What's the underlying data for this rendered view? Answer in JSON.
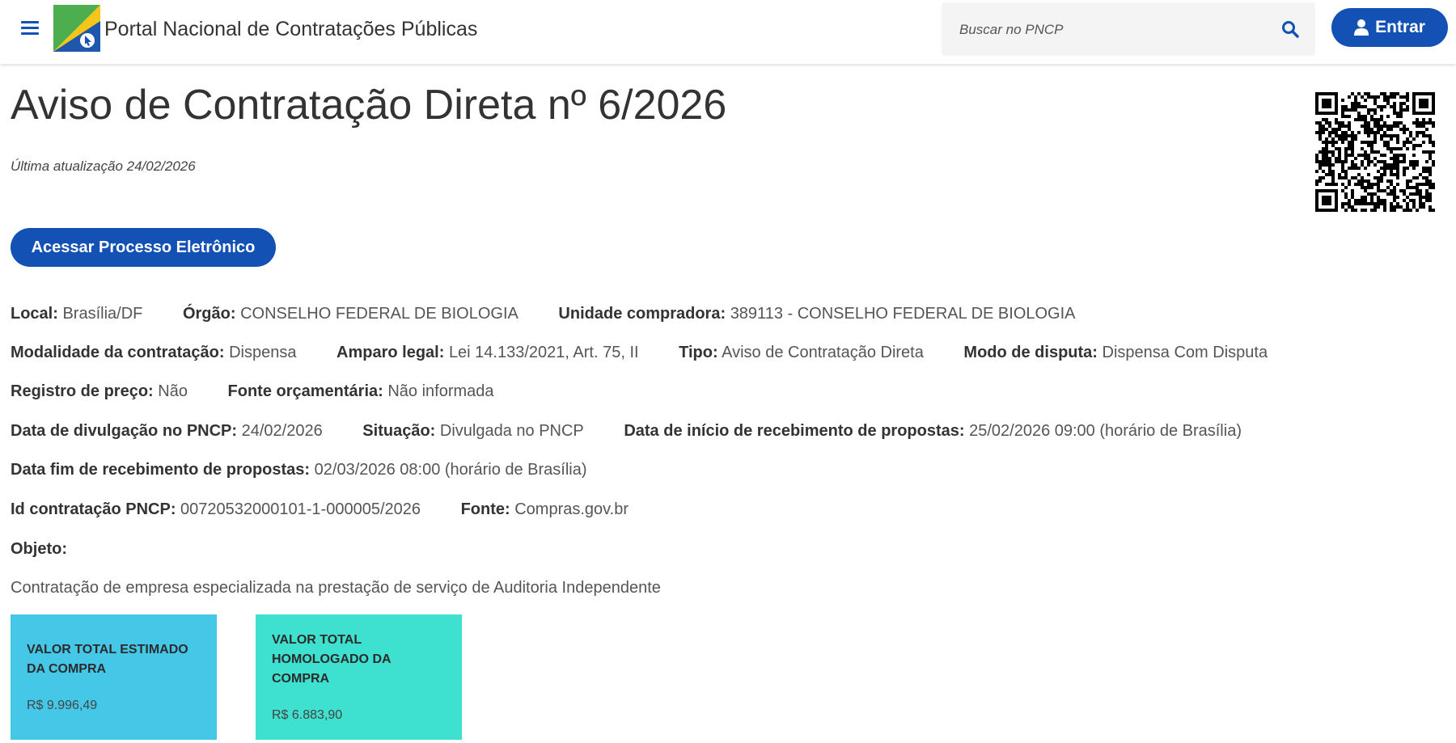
{
  "header": {
    "app_title": "Portal Nacional de Contratações Públicas",
    "search_placeholder": "Buscar no PNCP",
    "login_label": "Entrar"
  },
  "page": {
    "title": "Aviso de Contratação Direta nº 6/2026",
    "last_update": "Última atualização 24/02/2026",
    "process_button": "Acessar Processo Eletrônico"
  },
  "details": {
    "local": {
      "label": "Local:",
      "value": "Brasília/DF"
    },
    "orgao": {
      "label": "Órgão:",
      "value": "CONSELHO FEDERAL DE BIOLOGIA"
    },
    "unidade": {
      "label": "Unidade compradora:",
      "value": "389113 - CONSELHO FEDERAL DE BIOLOGIA"
    },
    "modalidade": {
      "label": "Modalidade da contratação:",
      "value": "Dispensa"
    },
    "amparo": {
      "label": "Amparo legal:",
      "value": "Lei 14.133/2021, Art. 75, II"
    },
    "tipo": {
      "label": "Tipo:",
      "value": "Aviso de Contratação Direta"
    },
    "modo": {
      "label": "Modo de disputa:",
      "value": "Dispensa Com Disputa"
    },
    "registro": {
      "label": "Registro de preço:",
      "value": "Não"
    },
    "fonte_orc": {
      "label": "Fonte orçamentária:",
      "value": "Não informada"
    },
    "divulgacao": {
      "label": "Data de divulgação no PNCP:",
      "value": "24/02/2026"
    },
    "situacao": {
      "label": "Situação:",
      "value": "Divulgada no PNCP"
    },
    "inicio": {
      "label": "Data de início de recebimento de propostas:",
      "value": "25/02/2026 09:00 (horário de Brasília)"
    },
    "fim": {
      "label": "Data fim de recebimento de propostas:",
      "value": "02/03/2026 08:00 (horário de Brasília)"
    },
    "id_pncp": {
      "label": "Id contratação PNCP:",
      "value": "00720532000101-1-000005/2026"
    },
    "fonte": {
      "label": "Fonte:",
      "value": "Compras.gov.br"
    },
    "objeto": {
      "label": "Objeto:",
      "value": "Contratação de empresa especializada na prestação de serviço de Auditoria Independente"
    }
  },
  "cards": [
    {
      "label": "VALOR TOTAL ESTIMADO DA COMPRA",
      "value": "R$ 9.996,49",
      "color": "#45c8e8"
    },
    {
      "label": "VALOR TOTAL HOMOLOGADO DA COMPRA",
      "value": "R$ 6.883,90",
      "color": "#3ee0cf"
    }
  ],
  "icons": {
    "menu": "hamburger-icon",
    "search": "search-icon",
    "user": "user-icon",
    "logo": "gov-logo",
    "qr": "qr-code"
  }
}
